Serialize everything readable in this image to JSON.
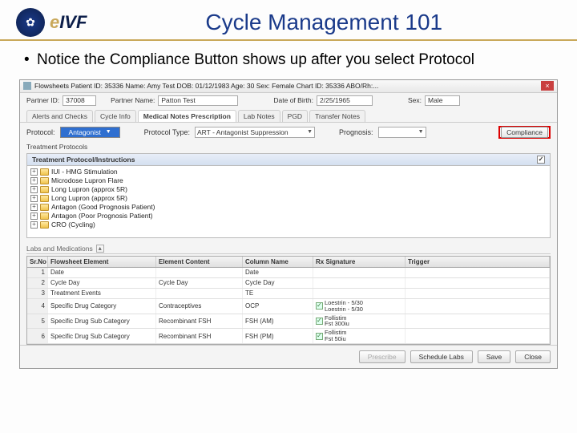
{
  "slide": {
    "title": "Cycle Management 101",
    "logo_e": "e",
    "logo_ivf": "IVF",
    "bullet": "Notice the Compliance Button shows up after you select Protocol"
  },
  "titlebar": "Flowsheets   Patient ID: 35336   Name: Amy Test   DOB: 01/12/1983   Age: 30   Sex: Female   Chart ID: 35336   ABO/Rh:...",
  "partner_row": {
    "partner_id_label": "Partner ID:",
    "partner_id": "37008",
    "partner_name_label": "Partner Name:",
    "partner_name": "Patton Test",
    "dob_label": "Date of Birth:",
    "dob": "2/25/1965",
    "sex_label": "Sex:",
    "sex": "Male"
  },
  "tabs": {
    "alerts": "Alerts and Checks",
    "cycle": "Cycle Info",
    "medical": "Medical Notes Prescription",
    "lab": "Lab Notes",
    "pgd": "PGD",
    "transfer": "Transfer Notes"
  },
  "protocol_row": {
    "protocol_label": "Protocol:",
    "protocol_value": "Antagonist",
    "ptype_label": "Protocol Type:",
    "ptype_value": "ART - Antagonist Suppression",
    "prognosis_label": "Prognosis:",
    "prognosis_value": "",
    "compliance": "Compliance"
  },
  "treatment": {
    "section": "Treatment Protocols",
    "header": "Treatment Protocol/Instructions",
    "items": [
      "IUI - HMG Stimulation",
      "Microdose Lupron Flare",
      "Long Lupron (approx 5R)",
      "Long Lupron (approx 5R)",
      "Antagon (Good Prognosis Patient)",
      "Antagon (Poor Prognosis Patient)",
      "CRO (Cycling)"
    ]
  },
  "labs": {
    "header": "Labs and Medications",
    "columns": {
      "sr": "Sr.No",
      "fe": "Flowsheet Element",
      "ec": "Element Content",
      "cn": "Column Name",
      "rx": "Rx Signature",
      "tr": "Trigger"
    },
    "rows": [
      {
        "sr": "1",
        "fe": "Date",
        "ec": "",
        "cn": "Date",
        "rx": "",
        "tr": ""
      },
      {
        "sr": "2",
        "fe": "Cycle Day",
        "ec": "Cycle Day",
        "cn": "Cycle Day",
        "rx": "",
        "tr": ""
      },
      {
        "sr": "3",
        "fe": "Treatment Events",
        "ec": "",
        "cn": "TE",
        "rx": "",
        "tr": ""
      },
      {
        "sr": "4",
        "fe": "Specific Drug Category",
        "ec": "Contraceptives",
        "cn": "OCP",
        "rx1": "Loestrin - 5/30",
        "rx2": "Loestrin - 5/30",
        "tr": ""
      },
      {
        "sr": "5",
        "fe": "Specific Drug Sub Category",
        "ec": "Recombinant FSH",
        "cn": "FSH (AM)",
        "rx1": "Follistim",
        "rx2": "Fst 300iu",
        "tr": ""
      },
      {
        "sr": "6",
        "fe": "Specific Drug Sub Category",
        "ec": "Recombinant FSH",
        "cn": "FSH (PM)",
        "rx1": "Follistim",
        "rx2": "Fst 50iu",
        "tr": ""
      }
    ]
  },
  "footer": {
    "prescribe": "Prescribe",
    "schedule": "Schedule Labs",
    "save": "Save",
    "close": "Close"
  }
}
